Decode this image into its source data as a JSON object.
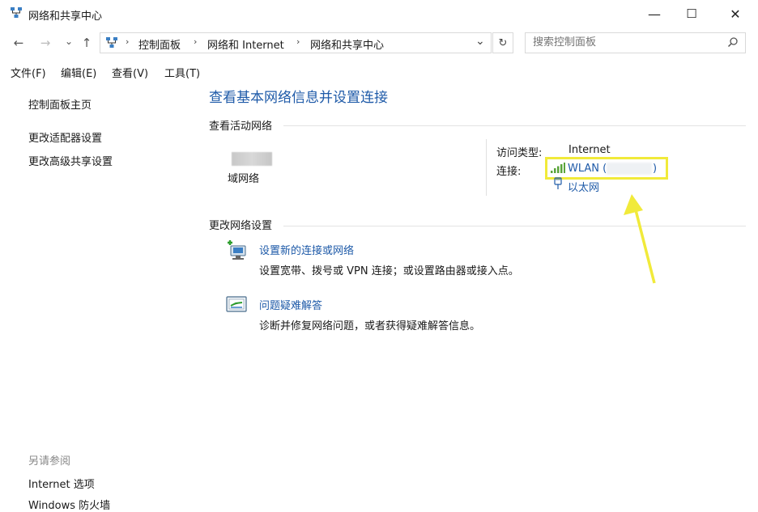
{
  "window": {
    "title": "网络和共享中心",
    "minimize_glyph": "—",
    "maximize_glyph": "☐",
    "close_glyph": "✕"
  },
  "nav": {
    "back_glyph": "←",
    "forward_glyph": "→",
    "recent_glyph": "⌄",
    "up_glyph": "↑",
    "refresh_glyph": "↻",
    "dropdown_glyph": "⌄"
  },
  "breadcrumb": [
    "控制面板",
    "网络和 Internet",
    "网络和共享中心"
  ],
  "breadcrumb_sep": "›",
  "search": {
    "placeholder": "搜索控制面板"
  },
  "menu": [
    "文件(F)",
    "编辑(E)",
    "查看(V)",
    "工具(T)"
  ],
  "left_pane": {
    "home": "控制面板主页",
    "links": [
      "更改适配器设置",
      "更改高级共享设置"
    ],
    "see_also_title": "另请参阅",
    "see_also": [
      "Internet 选项",
      "Windows 防火墙"
    ]
  },
  "main": {
    "title": "查看基本网络信息并设置连接",
    "active_networks_heading": "查看活动网络",
    "network_name": "域网络",
    "access_type_label": "访问类型:",
    "access_type_value": "Internet",
    "connections_label": "连接:",
    "wlan_link": "WLAN (",
    "wlan_close": ")",
    "ethernet_link": "以太网",
    "change_settings_heading": "更改网络设置",
    "tasks": [
      {
        "link": "设置新的连接或网络",
        "desc": "设置宽带、拨号或 VPN 连接；或设置路由器或接入点。"
      },
      {
        "link": "问题疑难解答",
        "desc": "诊断并修复网络问题，或者获得疑难解答信息。"
      }
    ]
  },
  "colors": {
    "link": "#1e5aa8",
    "highlight_border": "#f1ea3a",
    "arrow": "#f1ea3a"
  },
  "icons": {
    "app": "network-icon",
    "search": "search-icon",
    "signal": "wifi-signal-icon",
    "ethernet": "ethernet-icon",
    "new_connection": "new-connection-icon",
    "troubleshoot": "troubleshoot-icon"
  }
}
